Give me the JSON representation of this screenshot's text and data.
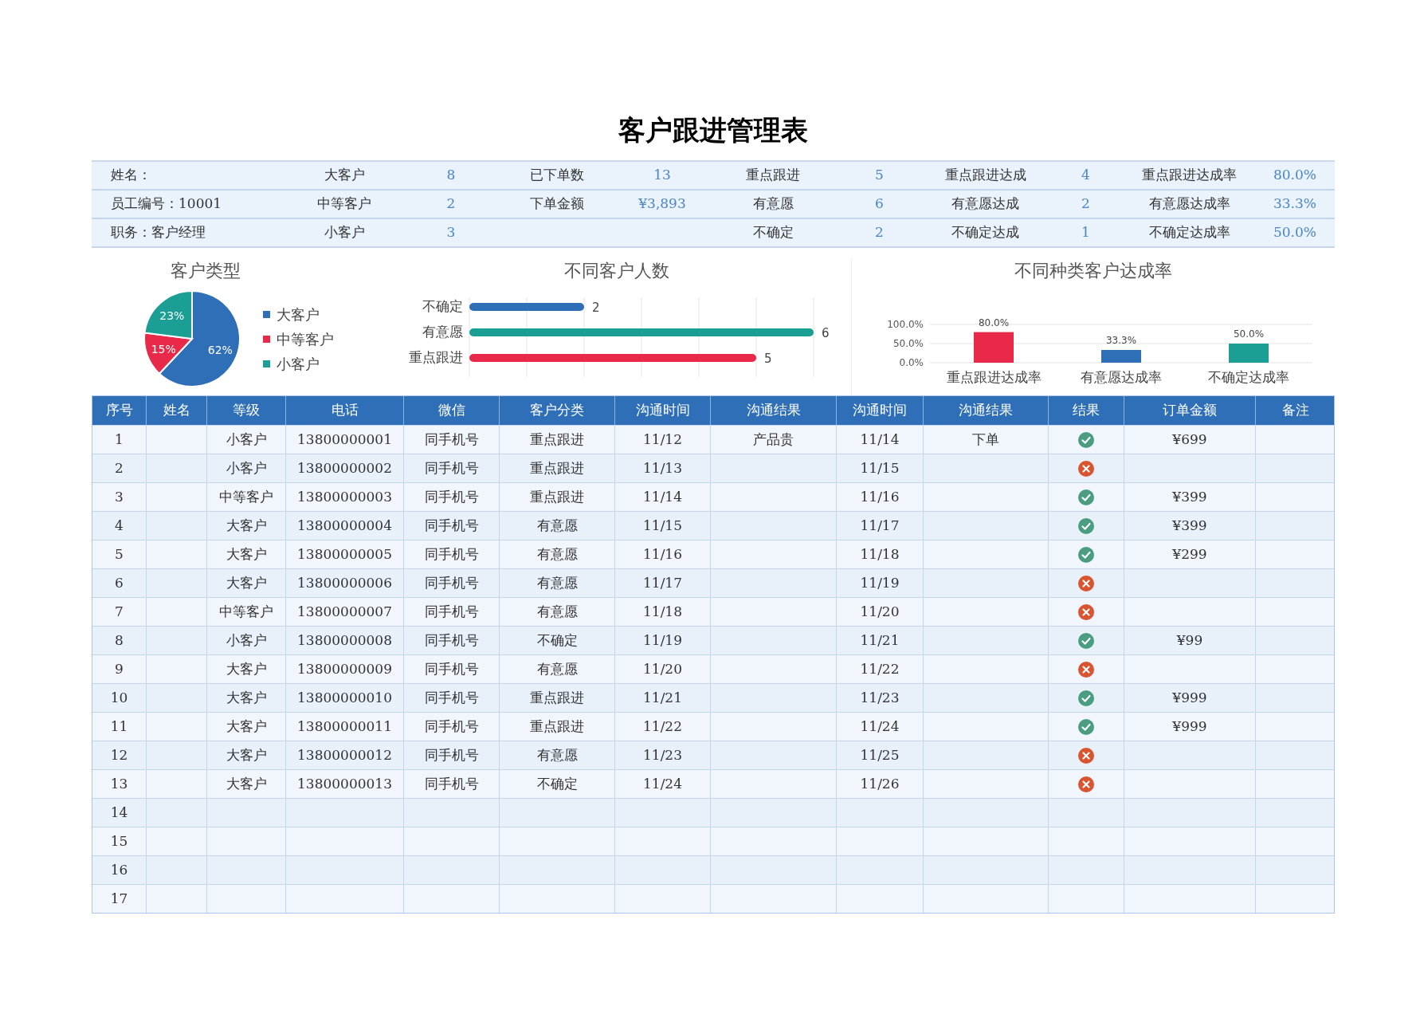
{
  "title": "客户跟进管理表",
  "summary": [
    {
      "info": "姓名：",
      "type_label": "大客户",
      "type_count": "8",
      "order_label": "已下单数",
      "order_value": "13",
      "follow_label": "重点跟进",
      "follow_count": "5",
      "done_label": "重点跟进达成",
      "done_count": "4",
      "rate_label": "重点跟进达成率",
      "rate_value": "80.0%"
    },
    {
      "info": "员工编号：10001",
      "type_label": "中等客户",
      "type_count": "2",
      "order_label": "下单金额",
      "order_value": "¥3,893",
      "follow_label": "有意愿",
      "follow_count": "6",
      "done_label": "有意愿达成",
      "done_count": "2",
      "rate_label": "有意愿达成率",
      "rate_value": "33.3%"
    },
    {
      "info": "职务：客户经理",
      "type_label": "小客户",
      "type_count": "3",
      "follow_label": "不确定",
      "follow_count": "2",
      "done_label": "不确定达成",
      "done_count": "1",
      "rate_label": "不确定达成率",
      "rate_value": "50.0%"
    }
  ],
  "charts": [
    {
      "chart_data": {
        "type": "pie",
        "title": "客户类型",
        "categories": [
          "大客户",
          "中等客户",
          "小客户"
        ],
        "values": [
          62,
          15,
          23
        ],
        "colors": [
          "#2e6fb7",
          "#e8294a",
          "#1b9e94"
        ],
        "value_labels": [
          "62%",
          "15%",
          "23%"
        ]
      }
    },
    {
      "chart_data": {
        "type": "bar",
        "orientation": "horizontal",
        "title": "不同客户人数",
        "categories": [
          "不确定",
          "有意愿",
          "重点跟进"
        ],
        "values": [
          2,
          6,
          5
        ],
        "colors": [
          "#2e6fb7",
          "#1b9e94",
          "#e8294a"
        ],
        "value_labels": [
          "2",
          "6",
          "5"
        ]
      }
    },
    {
      "chart_data": {
        "type": "bar",
        "title": "不同种类客户达成率",
        "categories": [
          "重点跟进达成率",
          "有意愿达成率",
          "不确定达成率"
        ],
        "values": [
          0.8,
          0.333,
          0.5
        ],
        "colors": [
          "#e8294a",
          "#2e6fb7",
          "#1b9e94"
        ],
        "ylim": [
          0,
          1
        ],
        "yticks": [
          {
            "value": 0,
            "label": "0.0%"
          },
          {
            "value": 0.5,
            "label": "50.0%"
          },
          {
            "value": 1,
            "label": "100.0%"
          }
        ],
        "value_labels": [
          "80.0%",
          "33.3%",
          "50.0%"
        ]
      }
    }
  ],
  "table": {
    "columns": [
      "序号",
      "姓名",
      "等级",
      "电话",
      "微信",
      "客户分类",
      "沟通时间",
      "沟通结果",
      "沟通时间",
      "沟通结果",
      "结果",
      "订单金额",
      "备注"
    ],
    "rows": [
      {
        "seq": "1",
        "level": "小客户",
        "phone": "13800000001",
        "wechat": "同手机号",
        "category": "重点跟进",
        "time_1": "11/12",
        "result_1": "产品贵",
        "time_2": "11/14",
        "result_2": "下单",
        "success": true,
        "amount": "¥699"
      },
      {
        "seq": "2",
        "level": "小客户",
        "phone": "13800000002",
        "wechat": "同手机号",
        "category": "重点跟进",
        "time_1": "11/13",
        "time_2": "11/15",
        "success": false
      },
      {
        "seq": "3",
        "level": "中等客户",
        "phone": "13800000003",
        "wechat": "同手机号",
        "category": "重点跟进",
        "time_1": "11/14",
        "time_2": "11/16",
        "success": true,
        "amount": "¥399"
      },
      {
        "seq": "4",
        "level": "大客户",
        "phone": "13800000004",
        "wechat": "同手机号",
        "category": "有意愿",
        "time_1": "11/15",
        "time_2": "11/17",
        "success": true,
        "amount": "¥399"
      },
      {
        "seq": "5",
        "level": "大客户",
        "phone": "13800000005",
        "wechat": "同手机号",
        "category": "有意愿",
        "time_1": "11/16",
        "time_2": "11/18",
        "success": true,
        "amount": "¥299"
      },
      {
        "seq": "6",
        "level": "大客户",
        "phone": "13800000006",
        "wechat": "同手机号",
        "category": "有意愿",
        "time_1": "11/17",
        "time_2": "11/19",
        "success": false
      },
      {
        "seq": "7",
        "level": "中等客户",
        "phone": "13800000007",
        "wechat": "同手机号",
        "category": "有意愿",
        "time_1": "11/18",
        "time_2": "11/20",
        "success": false
      },
      {
        "seq": "8",
        "level": "小客户",
        "phone": "13800000008",
        "wechat": "同手机号",
        "category": "不确定",
        "time_1": "11/19",
        "time_2": "11/21",
        "success": true,
        "amount": "¥99"
      },
      {
        "seq": "9",
        "level": "大客户",
        "phone": "13800000009",
        "wechat": "同手机号",
        "category": "有意愿",
        "time_1": "11/20",
        "time_2": "11/22",
        "success": false
      },
      {
        "seq": "10",
        "level": "大客户",
        "phone": "13800000010",
        "wechat": "同手机号",
        "category": "重点跟进",
        "time_1": "11/21",
        "time_2": "11/23",
        "success": true,
        "amount": "¥999"
      },
      {
        "seq": "11",
        "level": "大客户",
        "phone": "13800000011",
        "wechat": "同手机号",
        "category": "重点跟进",
        "time_1": "11/22",
        "time_2": "11/24",
        "success": true,
        "amount": "¥999"
      },
      {
        "seq": "12",
        "level": "大客户",
        "phone": "13800000012",
        "wechat": "同手机号",
        "category": "有意愿",
        "time_1": "11/23",
        "time_2": "11/25",
        "success": false
      },
      {
        "seq": "13",
        "level": "大客户",
        "phone": "13800000013",
        "wechat": "同手机号",
        "category": "不确定",
        "time_1": "11/24",
        "time_2": "11/26",
        "success": false
      },
      {
        "seq": "14"
      },
      {
        "seq": "15"
      },
      {
        "seq": "16"
      },
      {
        "seq": "17"
      }
    ]
  }
}
